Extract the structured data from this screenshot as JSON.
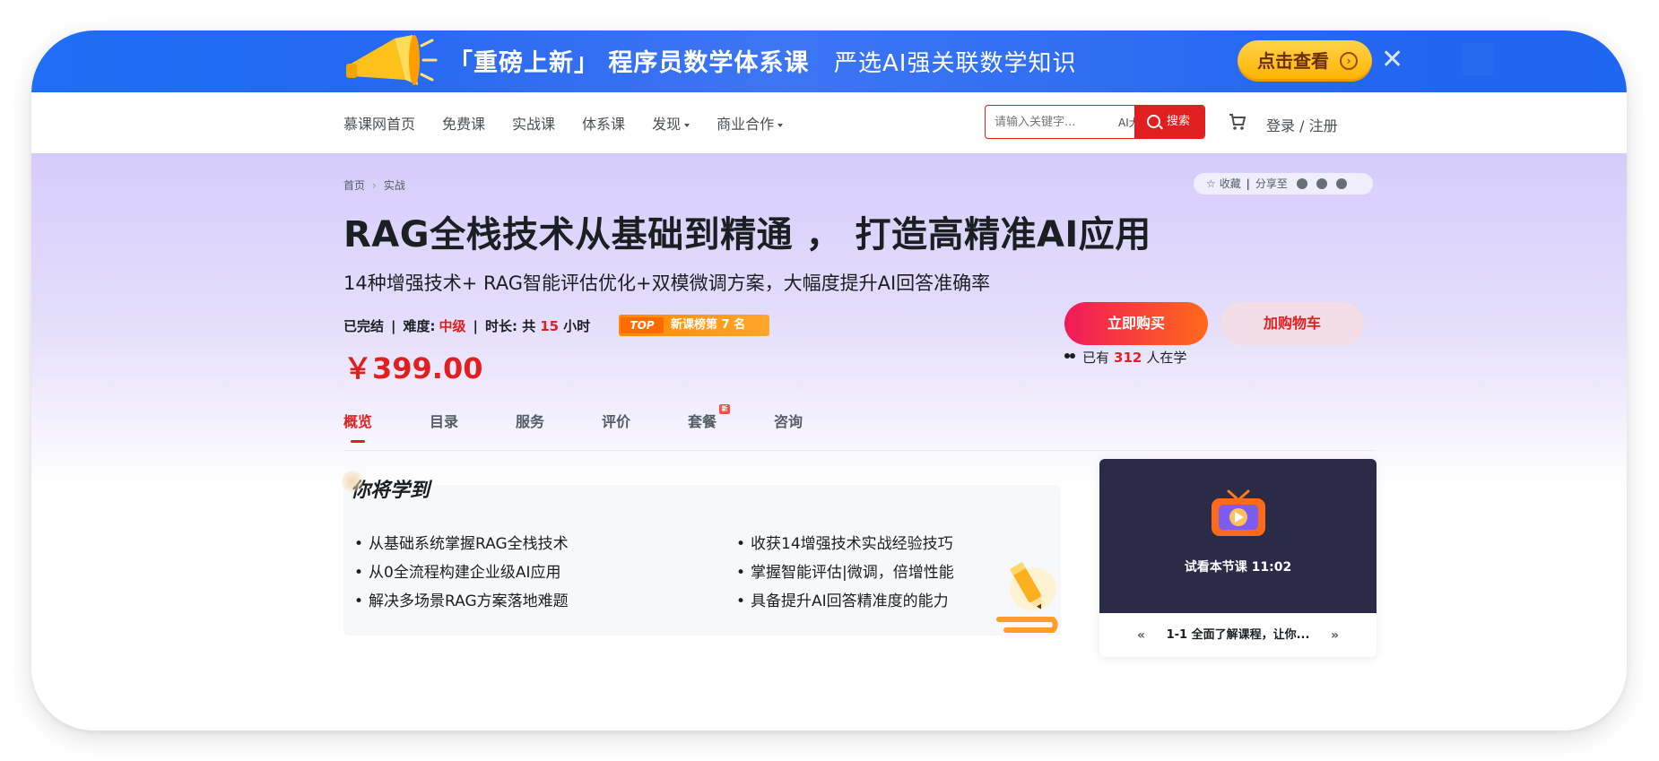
{
  "banner": {
    "title": "「重磅上新」 程序员数学体系课",
    "slogan": "严选AI强关联数学知识",
    "button_label": "点击查看",
    "close_icon": "close-icon",
    "accent": "#1f6ef5"
  },
  "nav": {
    "items": [
      {
        "label": "慕课网首页"
      },
      {
        "label": "免费课"
      },
      {
        "label": "实战课"
      },
      {
        "label": "体系课"
      },
      {
        "label": "发现"
      },
      {
        "label": "商业合作"
      }
    ],
    "search_placeholder": "请输入关键字...",
    "search_tag": "AI大模型",
    "search_button": "搜索",
    "login_label": "登录 / 注册"
  },
  "breadcrumb": {
    "home": "首页",
    "current": "实战"
  },
  "share": {
    "collect": "收藏",
    "share_to": "分享至"
  },
  "course": {
    "title": "RAG全栈技术从基础到精通 ， 打造高精准AI应用",
    "subtitle": "14种增强技术+ RAG智能评估优化+双模微调方案，大幅度提升AI回答准确率",
    "status": "已完结",
    "difficulty_label": "难度:",
    "difficulty": "中级",
    "duration_label": "时长: 共",
    "duration_value": "15",
    "duration_unit": "小时",
    "rank_badge": "TOP",
    "rank_text": "新课榜第 7 名",
    "price": "￥399.00",
    "buy_label": "立即购买",
    "add_cart_label": "加购物车",
    "learners_prefix": "已有",
    "learners_count": "312",
    "learners_suffix": "人在学",
    "accent": "#e02020"
  },
  "tabs": [
    {
      "label": "概览",
      "active": true
    },
    {
      "label": "目录"
    },
    {
      "label": "服务"
    },
    {
      "label": "评价"
    },
    {
      "label": "套餐",
      "badge": "新"
    },
    {
      "label": "咨询"
    }
  ],
  "learn": {
    "heading": "你将学到",
    "left": [
      "从基础系统掌握RAG全栈技术",
      "从0全流程构建企业级AI应用",
      "解决多场景RAG方案落地难题"
    ],
    "right": [
      "收获14增强技术实战经验技巧",
      "掌握智能评估|微调，倍增性能",
      "具备提升AI回答精准度的能力"
    ]
  },
  "player": {
    "label": "试看本节课 11:02",
    "lesson": "1-1 全面了解课程，让你...",
    "prev": "«",
    "next": "»"
  }
}
